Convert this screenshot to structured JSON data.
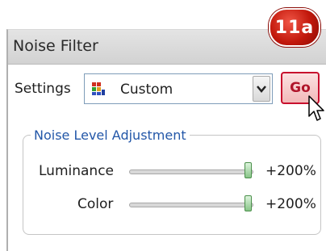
{
  "panel": {
    "title": "Noise Filter"
  },
  "badge": {
    "label": "11a"
  },
  "settings": {
    "label": "Settings",
    "selected": "Custom",
    "icon": "custom-preset-icon",
    "go_label": "Go"
  },
  "noise_group": {
    "legend": "Noise Level Adjustment",
    "sliders": [
      {
        "label": "Luminance",
        "value_text": "+200%",
        "level": 1.0
      },
      {
        "label": "Color",
        "value_text": "+200%",
        "level": 1.0
      }
    ]
  },
  "colors": {
    "accent_red": "#c8102e",
    "legend_blue": "#2357a8",
    "thumb_green": "#88c488"
  }
}
